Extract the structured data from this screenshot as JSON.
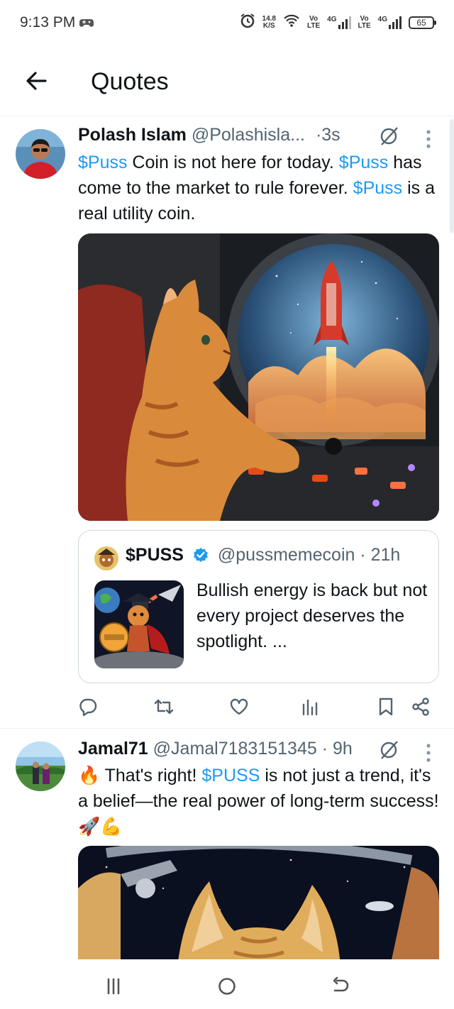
{
  "status_bar": {
    "time": "9:13 PM",
    "net_speed_value": "14.8",
    "net_speed_unit": "K/S",
    "sim1_top": "Vo",
    "sim1_bottom": "LTE",
    "sim1_gen": "4G",
    "sim2_top": "Vo",
    "sim2_bottom": "LTE",
    "sim2_gen": "4G",
    "battery": "65"
  },
  "header": {
    "title": "Quotes"
  },
  "tweets": [
    {
      "name": "Polash Islam",
      "handle": "@Polashisla...",
      "time": "·3s",
      "text_parts": [
        "$Puss",
        " Coin is not here for today. ",
        "$Puss",
        " has come to the market to rule forever. ",
        "$Puss",
        " is a real utility coin."
      ],
      "quote": {
        "name": "$PUSS",
        "handle": "@pussmemecoin · 21h",
        "text": "Bullish energy is back  but not every project deserves the spotlight. ..."
      }
    },
    {
      "name": "Jamal71",
      "handle": "@Jamal7183151345 · 9h",
      "text_parts": [
        "🔥 That's right! ",
        "$PUSS",
        " is not just a trend, it's a belief—the real power of long-term success! 🚀💪"
      ]
    }
  ],
  "colors": {
    "accent": "#1d9bf0",
    "text": "#0f1419",
    "secondary": "#536471",
    "border": "#cfd9de"
  },
  "icons": [
    "back-arrow-icon",
    "grok-icon",
    "more-vertical-icon",
    "reply-icon",
    "retweet-icon",
    "like-icon",
    "views-icon",
    "bookmark-icon",
    "share-icon",
    "verified-badge-icon",
    "recent-apps-icon",
    "home-icon",
    "back-icon"
  ]
}
